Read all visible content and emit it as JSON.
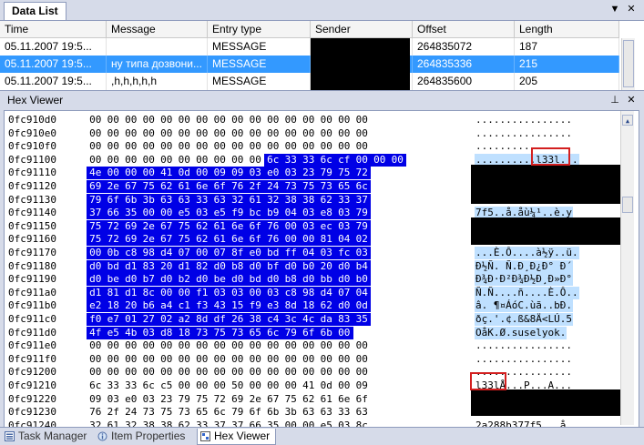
{
  "data_list": {
    "tab_label": "Data List",
    "controls": {
      "dropdown": "▼",
      "close": "✕"
    },
    "columns": [
      "Time",
      "Message",
      "Entry type",
      "Sender",
      "Offset",
      "Length"
    ],
    "rows": [
      {
        "time": "05.11.2007 19:5...",
        "message": "",
        "entry_type": "MESSAGE",
        "sender": "",
        "offset": "264835072",
        "length": "187"
      },
      {
        "time": "05.11.2007 19:5...",
        "message": "ну типа дозвони...",
        "entry_type": "MESSAGE",
        "sender": "",
        "offset": "264835336",
        "length": "215"
      },
      {
        "time": "05.11.2007 19:5...",
        "message": ",h,h,h,h,h",
        "entry_type": "MESSAGE",
        "sender": "",
        "offset": "264835600",
        "length": "205"
      }
    ],
    "selected_row": 1
  },
  "hex_viewer": {
    "title": "Hex Viewer",
    "controls": {
      "pin": "⊥",
      "close": "✕"
    },
    "lines": [
      {
        "offset": "0fc910d0",
        "bytes": "00 00 00 00 00 00 00 00 00 00 00 00 00 00 00 00",
        "ascii": "................"
      },
      {
        "offset": "0fc910e0",
        "bytes": "00 00 00 00 00 00 00 00 00 00 00 00 00 00 00 00",
        "ascii": "................"
      },
      {
        "offset": "0fc910f0",
        "bytes": "00 00 00 00 00 00 00 00 00 00 00 00 00 00 00 00",
        "ascii": "................"
      },
      {
        "offset": "0fc91100",
        "bytes": "00 00 00 00 00 00 00 00 00 00 6c 33 33 6c cf 00 00 00",
        "ascii": "..........l33l..."
      },
      {
        "offset": "0fc91110",
        "bytes": "4e 00 00 00 41 0d 00 09 09 03 e0 03 23 79 75 72",
        "ascii": ""
      },
      {
        "offset": "0fc91120",
        "bytes": "69 2e 67 75 62 61 6e 6f 76 2f 24 73 75 73 65 6c",
        "ascii": ""
      },
      {
        "offset": "0fc91130",
        "bytes": "79 6f 6b 3b 63 63 33 63 32 61 32 38 38 62 33 37",
        "ascii": ""
      },
      {
        "offset": "0fc91140",
        "bytes": "37 66 35 00 00 e5 03 e5 f9 bc b9 04 03 e8 03 79",
        "ascii": "7f5..å.åù¼¹..è.y"
      },
      {
        "offset": "0fc91150",
        "bytes": "75 72 69 2e 67 75 62 61 6e 6f 76 00 03 ec 03 79",
        "ascii": ""
      },
      {
        "offset": "0fc91160",
        "bytes": "75 72 69 2e 67 75 62 61 6e 6f 76 00 00 81 04 02",
        "ascii": ""
      },
      {
        "offset": "0fc91170",
        "bytes": "00 0b c8 98 d4 07 00 07 8f e0 bd ff 04 03 fc 03",
        "ascii": "...È.Ô....à½ÿ..ü."
      },
      {
        "offset": "0fc91180",
        "bytes": "d0 bd d1 83 20 d1 82 d0 b8 d0 bf d0 b0 20 d0 b4",
        "ascii": "Ð½Ñ. Ñ.Ð¸Ð¿Ð° Ð´"
      },
      {
        "offset": "0fc91190",
        "bytes": "d0 be d0 b7 d0 b2 d0 be d0 bd d0 b8 d0 bb d0 b0",
        "ascii": "Ð¾Ð·Ð²Ð¾Ð½Ð¸Ð»Ð°"
      },
      {
        "offset": "0fc911a0",
        "bytes": "d1 81 d1 8c 00 00 f1 03 03 00 03 c8 98 d4 07 04",
        "ascii": "Ñ.Ñ....ñ....È.Ô.."
      },
      {
        "offset": "0fc911b0",
        "bytes": "e2 18 20 b6 a4 c1 f3 43 15 f9 e3 8d 18 62 d0 0d",
        "ascii": "â. ¶¤ÁóC.ùã..bÐ."
      },
      {
        "offset": "0fc911c0",
        "bytes": "f0 e7 01 27 02 a2 8d df 26 38 c4 3c 4c da 83 35",
        "ascii": "ðç.'.¢.ß&8Ä<LÚ.5"
      },
      {
        "offset": "0fc911d0",
        "bytes": "4f e5 4b 03 d8 18 73 75 73 65 6c 79 6f 6b 00",
        "ascii": "OåK.Ø.suselyok."
      },
      {
        "offset": "0fc911e0",
        "bytes": "00 00 00 00 00 00 00 00 00 00 00 00 00 00 00 00",
        "ascii": "................"
      },
      {
        "offset": "0fc911f0",
        "bytes": "00 00 00 00 00 00 00 00 00 00 00 00 00 00 00 00",
        "ascii": "................"
      },
      {
        "offset": "0fc91200",
        "bytes": "00 00 00 00 00 00 00 00 00 00 00 00 00 00 00 00",
        "ascii": "................"
      },
      {
        "offset": "0fc91210",
        "bytes": "6c 33 33 6c c5 00 00 00 50 00 00 00 41 0d 00 09",
        "ascii": "l33lÅ...P...A..."
      },
      {
        "offset": "0fc91220",
        "bytes": "09 03 e0 03 23 79 75 72 69 2e 67 75 62 61 6e 6f",
        "ascii": ""
      },
      {
        "offset": "0fc91230",
        "bytes": "76 2f 24 73 75 73 65 6c 79 6f 6b 3b 63 63 33 63",
        "ascii": ""
      },
      {
        "offset": "0fc91240",
        "bytes": "32 61 32 38 38 62 33 37 37 66 35 00 00 e5 03 8c",
        "ascii": "2a288b377f5...å.."
      }
    ]
  },
  "bottom_tabs": [
    {
      "label": "Task Manager",
      "icon": "task-manager-icon"
    },
    {
      "label": "Item Properties",
      "icon": "item-properties-icon"
    },
    {
      "label": "Hex Viewer",
      "icon": "hex-viewer-icon"
    }
  ],
  "colors": {
    "selection": "#3399ff",
    "hex_highlight": "#0000e6",
    "ascii_highlight": "#bfe0ff",
    "annotation": "#d31f1f"
  }
}
